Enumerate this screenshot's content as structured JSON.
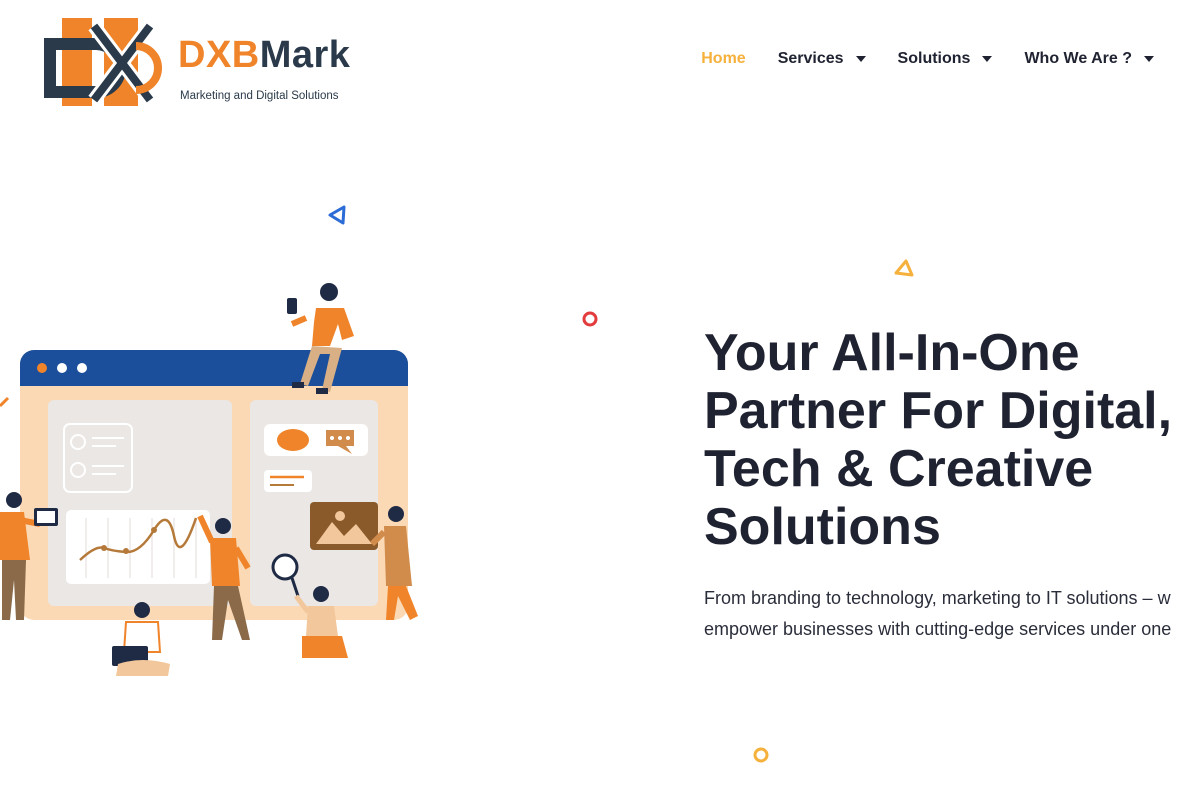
{
  "brand": {
    "name_part1": "DXB",
    "name_part2": "Mark",
    "tagline": "Marketing and Digital Solutions"
  },
  "nav": {
    "items": [
      {
        "label": "Home",
        "active": true,
        "has_dropdown": false
      },
      {
        "label": "Services",
        "active": false,
        "has_dropdown": true
      },
      {
        "label": "Solutions",
        "active": false,
        "has_dropdown": true
      },
      {
        "label": "Who We Are ?",
        "active": false,
        "has_dropdown": true
      }
    ]
  },
  "hero": {
    "title_lines": [
      "Your All-In-One",
      "Partner For Digital,",
      "Tech & Creative",
      "Solutions"
    ],
    "description_lines": [
      "From branding to technology, marketing to IT solutions – w",
      "empower businesses with cutting-edge services under one"
    ]
  },
  "colors": {
    "accent_orange": "#f0842a",
    "accent_yellow": "#f6b13c",
    "dark_text": "#1f2230",
    "window_blue": "#1b4f9c",
    "deco_red": "#e23c3c",
    "deco_blue": "#2c6cd6"
  },
  "icons": [
    "dxb-logo-icon",
    "chevron-down-icon",
    "triangle-icon",
    "ring-icon"
  ]
}
